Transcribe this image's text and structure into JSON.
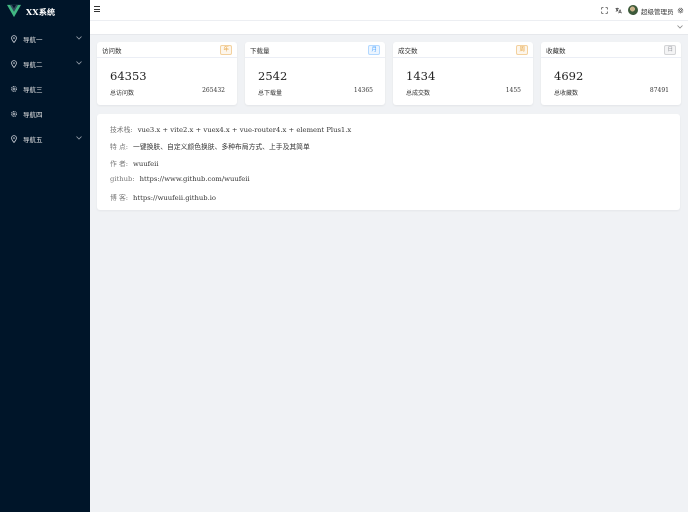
{
  "app": {
    "title": "XX系统"
  },
  "sidebar": {
    "items": [
      {
        "label": "导航一",
        "icon": "location-icon",
        "has_submenu": true
      },
      {
        "label": "导航二",
        "icon": "location-icon",
        "has_submenu": true
      },
      {
        "label": "导航三",
        "icon": "gear-icon",
        "has_submenu": false
      },
      {
        "label": "导航四",
        "icon": "gear-icon",
        "has_submenu": false
      },
      {
        "label": "导航五",
        "icon": "location-icon",
        "has_submenu": true
      }
    ]
  },
  "header": {
    "user_name": "超级管理员",
    "icons": [
      "menu-icon",
      "fullscreen-icon",
      "translate-icon",
      "settings-icon"
    ]
  },
  "cards": [
    {
      "title": "访问数",
      "tag": "年",
      "tag_color": "#e6a23c",
      "value": "64353",
      "foot_label": "总访问数",
      "foot_value": "265432"
    },
    {
      "title": "下载量",
      "tag": "月",
      "tag_color": "#409eff",
      "value": "2542",
      "foot_label": "总下载量",
      "foot_value": "14365"
    },
    {
      "title": "成交数",
      "tag": "周",
      "tag_color": "#e6a23c",
      "value": "1434",
      "foot_label": "总成交数",
      "foot_value": "1455"
    },
    {
      "title": "收藏数",
      "tag": "日",
      "tag_color": "#909399",
      "value": "4692",
      "foot_label": "总收藏数",
      "foot_value": "87491"
    }
  ],
  "info": {
    "tech_label": "技术栈:",
    "tech_value": "vue3.x + vite2.x + vuex4.x + vue-router4.x + element Plus1.x",
    "feature_label": "特 点:",
    "feature_value": "一键换肤、自定义颜色换肤、多种布局方式、上手及其简单",
    "author_label": "作 者:",
    "author_value": "wuufeii",
    "github_label": "github:",
    "github_value": "https://www.github.com/wuufeii",
    "blog_label": "博 客:",
    "blog_value": "https://wuufeii.github.io"
  },
  "colors": {
    "sidebar_bg": "#001529",
    "logo_green": "#41b883",
    "logo_dark": "#35495e"
  }
}
